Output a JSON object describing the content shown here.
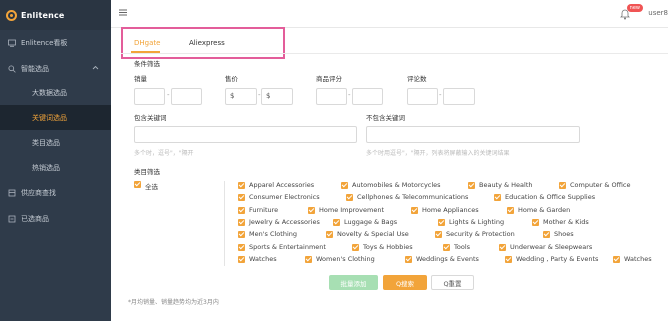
{
  "app": {
    "logo_text": "Enlitence"
  },
  "sidebar": {
    "items": [
      {
        "label": "Enlitence看板",
        "icon": "dashboard-icon"
      },
      {
        "label": "智能选品",
        "icon": "search-icon",
        "expanded": true
      }
    ],
    "sub_items": [
      {
        "label": "大数据选品",
        "active": false
      },
      {
        "label": "关键词选品",
        "active": true
      },
      {
        "label": "类目选品",
        "active": false
      },
      {
        "label": "热销选品",
        "active": false
      }
    ],
    "bottom_items": [
      {
        "label": "供应商查找",
        "icon": "supplier-icon"
      },
      {
        "label": "已选商品",
        "icon": "selected-icon"
      }
    ]
  },
  "header": {
    "menu_icon": "hamburger-icon",
    "bell_icon": "bell-icon",
    "badge": "new",
    "user": "user8"
  },
  "tabs": [
    {
      "label": "DHgate",
      "active": true
    },
    {
      "label": "Aliexpress",
      "active": false
    }
  ],
  "filters": {
    "section_title": "条件筛选",
    "sales_label": "销量",
    "price_label": "售价",
    "price_prefix_min": "$",
    "price_prefix_max": "$",
    "rating_label": "商品评分",
    "reviews_label": "评论数",
    "dash": "-",
    "include_label": "包含关键词",
    "include_hint": "多个时，逗号\"，\"隔开",
    "exclude_label": "不包含关键词",
    "exclude_hint": "多个时用逗号\"，\"隔开，列表将屏蔽输入的关键词结果"
  },
  "categories": {
    "title": "类目筛选",
    "select_all": "全选",
    "rows": [
      [
        "Apparel Accessories",
        "Automobiles & Motorcycles",
        "Beauty & Health",
        "Computer & Office"
      ],
      [
        "Consumer Electronics",
        "Cellphones & Telecommunications",
        "Education & Office Supplies"
      ],
      [
        "Furniture",
        "Home Improvement",
        "Home Appliances",
        "Home & Garden"
      ],
      [
        "Jewelry & Accessories",
        "Luggage & Bags",
        "Lights & Lighting",
        "Mother & Kids"
      ],
      [
        "Men's Clothing",
        "Novelty & Special Use",
        "Security & Protection",
        "Shoes"
      ],
      [
        "Sports & Entertainment",
        "Toys & Hobbies",
        "Tools",
        "Underwear & Sleepwears"
      ],
      [
        "Watches",
        "Women's Clothing",
        "Weddings & Events",
        "Wedding , Party & Events",
        "Watches"
      ]
    ]
  },
  "buttons": {
    "batch_add": "批量添加",
    "search": "Q搜索",
    "reset": "Q重置"
  },
  "footnote": "*月均销量、销量趋势均为近3月内",
  "colors": {
    "accent": "#f2a43a",
    "sidebar_bg": "#2f3b4a",
    "highlight_box": "#e35d9a"
  }
}
